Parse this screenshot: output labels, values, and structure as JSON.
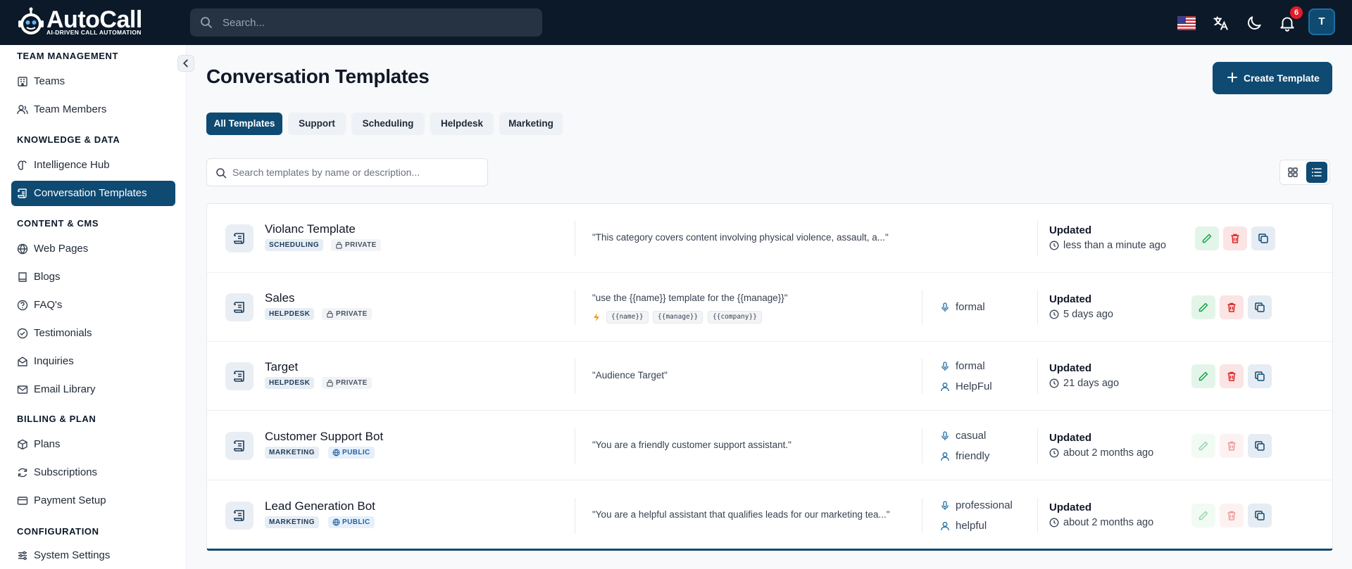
{
  "app": {
    "brand": "AutoCall",
    "tagline": "AI-DRIVEN CALL AUTOMATION",
    "search_placeholder": "Search...",
    "notifications_count": "6",
    "avatar_initial": "T"
  },
  "sidebar": {
    "sections": [
      {
        "title": "TEAM MANAGEMENT",
        "items": [
          {
            "label": "Teams",
            "icon": "building-icon"
          },
          {
            "label": "Team Members",
            "icon": "users-icon"
          }
        ]
      },
      {
        "title": "KNOWLEDGE & DATA",
        "items": [
          {
            "label": "Intelligence Hub",
            "icon": "brain-icon"
          },
          {
            "label": "Conversation Templates",
            "icon": "scroll-icon",
            "active": true
          }
        ]
      },
      {
        "title": "CONTENT & CMS",
        "items": [
          {
            "label": "Web Pages",
            "icon": "globe-icon"
          },
          {
            "label": "Blogs",
            "icon": "book-icon"
          },
          {
            "label": "FAQ's",
            "icon": "help-circle-icon"
          },
          {
            "label": "Testimonials",
            "icon": "check-circle-icon"
          },
          {
            "label": "Inquiries",
            "icon": "mail-open-icon"
          },
          {
            "label": "Email Library",
            "icon": "mail-icon"
          }
        ]
      },
      {
        "title": "BILLING & PLAN",
        "items": [
          {
            "label": "Plans",
            "icon": "package-icon"
          },
          {
            "label": "Subscriptions",
            "icon": "refresh-icon"
          },
          {
            "label": "Payment Setup",
            "icon": "credit-card-icon"
          }
        ]
      },
      {
        "title": "CONFIGURATION",
        "items": [
          {
            "label": "System Settings",
            "icon": "sliders-icon"
          }
        ]
      }
    ]
  },
  "main": {
    "title": "Conversation Templates",
    "create_label": "Create Template",
    "tabs": [
      "All Templates",
      "Support",
      "Scheduling",
      "Helpdesk",
      "Marketing"
    ],
    "active_tab": "All Templates",
    "search_placeholder": "Search templates by name or description...",
    "view_mode": "list",
    "templates": [
      {
        "name": "Violanc Template",
        "category": "SCHEDULING",
        "visibility": "PRIVATE",
        "description": "\"This category covers content involving physical violence, assault, a...\"",
        "variables": [],
        "tone": "",
        "persona": "",
        "updated_label": "Updated",
        "updated_ago": "less than a minute ago"
      },
      {
        "name": "Sales",
        "category": "HELPDESK",
        "visibility": "PRIVATE",
        "description": "\"use the {{name}} template for the {{manage}}\"",
        "variables": [
          "{{name}}",
          "{{manage}}",
          "{{company}}"
        ],
        "tone": "formal",
        "persona": "",
        "updated_label": "Updated",
        "updated_ago": "5 days ago"
      },
      {
        "name": "Target",
        "category": "HELPDESK",
        "visibility": "PRIVATE",
        "description": "\"Audience Target\"",
        "variables": [],
        "tone": "formal",
        "persona": "HelpFul",
        "updated_label": "Updated",
        "updated_ago": "21 days ago"
      },
      {
        "name": "Customer Support Bot",
        "category": "MARKETING",
        "visibility": "PUBLIC",
        "description": "\"You are a friendly customer support assistant.\"",
        "variables": [],
        "tone": "casual",
        "persona": "friendly",
        "updated_label": "Updated",
        "updated_ago": "about 2 months ago"
      },
      {
        "name": "Lead Generation Bot",
        "category": "MARKETING",
        "visibility": "PUBLIC",
        "description": "\"You are a helpful assistant that qualifies leads for our marketing tea...\"",
        "variables": [],
        "tone": "professional",
        "persona": "helpful",
        "updated_label": "Updated",
        "updated_ago": "about 2 months ago"
      }
    ]
  },
  "colors": {
    "primary": "#0e4a72",
    "topbar": "#0b1929",
    "badge": "#e11d2a",
    "edit": "#16a34a",
    "delete": "#dc2626"
  }
}
